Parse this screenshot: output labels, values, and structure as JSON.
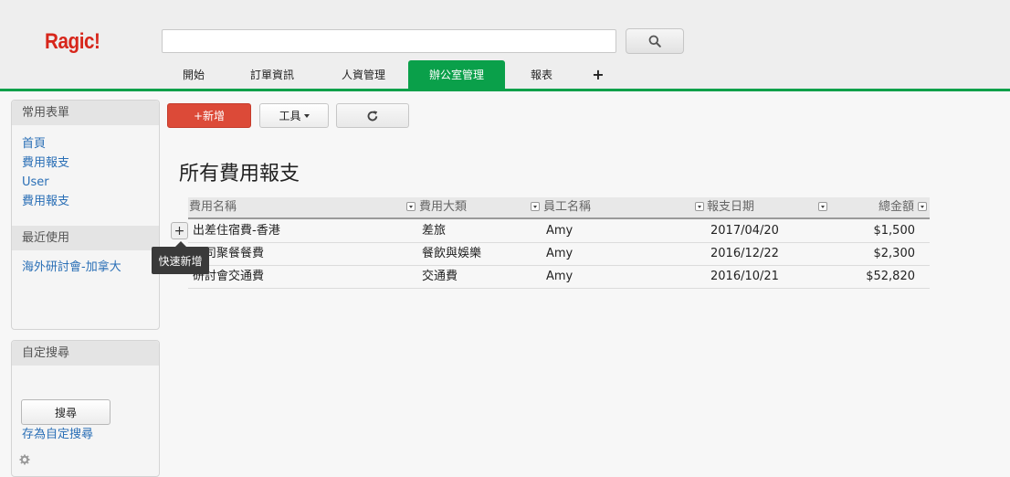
{
  "app": {
    "logo": "Ragic!"
  },
  "search": {
    "placeholder": "",
    "value": ""
  },
  "tabs": [
    {
      "label": "開始"
    },
    {
      "label": "訂單資訊"
    },
    {
      "label": "人資管理"
    },
    {
      "label": "辦公室管理",
      "active": true
    },
    {
      "label": "報表"
    },
    {
      "label": "+"
    }
  ],
  "sidebar": {
    "favorites": {
      "title": "常用表單",
      "items": [
        "首頁",
        "費用報支",
        "User",
        "費用報支"
      ]
    },
    "recent": {
      "title": "最近使用",
      "items": [
        "海外研討會-加拿大"
      ]
    },
    "custom_search": {
      "title": "自定搜尋",
      "search_button": "搜尋",
      "save_link": "存為自定搜尋"
    }
  },
  "toolbar": {
    "new_label": "+新增",
    "tools_label": "工具",
    "refresh_icon": "refresh-icon"
  },
  "page": {
    "title": "所有費用報支"
  },
  "table": {
    "columns": [
      "費用名稱",
      "費用大類",
      "員工名稱",
      "報支日期",
      "總金額"
    ],
    "rows": [
      [
        "出差住宿費-香港",
        "差旅",
        "Amy",
        "2017/04/20",
        "$1,500"
      ],
      [
        "公司聚餐餐費",
        "餐飲與娛樂",
        "Amy",
        "2016/12/22",
        "$2,300"
      ],
      [
        "研討會交通費",
        "交通費",
        "Amy",
        "2016/10/21",
        "$52,820"
      ]
    ]
  },
  "quick_add": {
    "button": "+",
    "tooltip": "快速新增"
  },
  "colors": {
    "brand_red": "#d7261b",
    "accent_green": "#0aa04a",
    "new_button": "#dc4a38",
    "link": "#2a6fb6"
  }
}
